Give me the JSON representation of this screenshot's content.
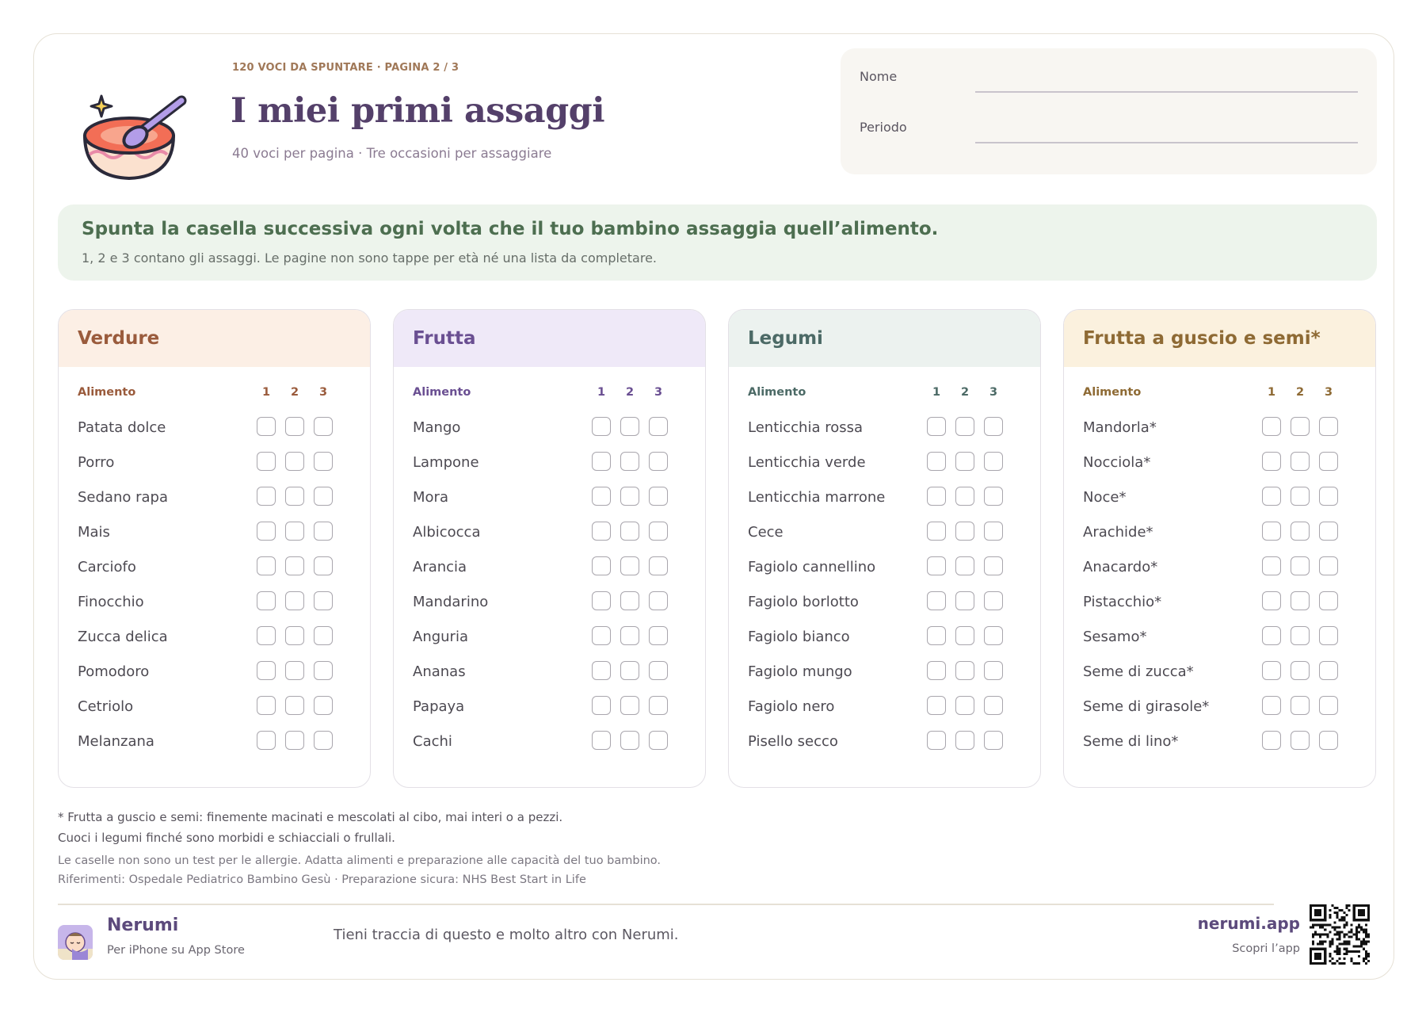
{
  "header": {
    "eyebrow": "120 VOCI DA SPUNTARE · PAGINA 2 / 3",
    "title": "I miei primi assaggi",
    "subtitle": "40 voci per pagina · Tre occasioni per assaggiare",
    "logo_icon": "baby-food-bowl-icon"
  },
  "form": {
    "name_label": "Nome",
    "period_label": "Periodo"
  },
  "banner": {
    "title": "Spunta la casella successiva ogni volta che il tuo bambino assaggia quell’alimento.",
    "subtitle": "1, 2 e 3 contano gli assaggi. Le pagine non sono tappe per età né una lista da completare."
  },
  "table_labels": {
    "food": "Alimento",
    "n1": "1",
    "n2": "2",
    "n3": "3"
  },
  "categories": [
    {
      "title": "Verdure",
      "head_bg": "#fcefe5",
      "accent": "#9a5b3c",
      "items": [
        "Patata dolce",
        "Porro",
        "Sedano rapa",
        "Mais",
        "Carciofo",
        "Finocchio",
        "Zucca delica",
        "Pomodoro",
        "Cetriolo",
        "Melanzana"
      ]
    },
    {
      "title": "Frutta",
      "head_bg": "#efe9f8",
      "accent": "#6a4f92",
      "items": [
        "Mango",
        "Lampone",
        "Mora",
        "Albicocca",
        "Arancia",
        "Mandarino",
        "Anguria",
        "Ananas",
        "Papaya",
        "Cachi"
      ]
    },
    {
      "title": "Legumi",
      "head_bg": "#ecf2ef",
      "accent": "#4c6a66",
      "items": [
        "Lenticchia rossa",
        "Lenticchia verde",
        "Lenticchia marrone",
        "Cece",
        "Fagiolo cannellino",
        "Fagiolo borlotto",
        "Fagiolo bianco",
        "Fagiolo mungo",
        "Fagiolo nero",
        "Pisello secco"
      ]
    },
    {
      "title": "Frutta a guscio e semi*",
      "head_bg": "#fbf1de",
      "accent": "#8e6a34",
      "items": [
        "Mandorla*",
        "Nocciola*",
        "Noce*",
        "Arachide*",
        "Anacardo*",
        "Pistacchio*",
        "Sesamo*",
        "Seme di zucca*",
        "Seme di girasole*",
        "Seme di lino*"
      ]
    }
  ],
  "notes": {
    "line1": "* Frutta a guscio e semi: finemente macinati e mescolati al cibo, mai interi o a pezzi.",
    "line2": "Cuoci i legumi finché sono morbidi e schiacciali o frullali.",
    "line3": "Le caselle non sono un test per le allergie. Adatta alimenti e preparazione alle capacità del tuo bambino.",
    "line4": "Riferimenti: Ospedale Pediatrico Bambino Gesù · Preparazione sicura: NHS Best Start in Life"
  },
  "footer": {
    "brand": "Nerumi",
    "brand_sub": "Per iPhone su App Store",
    "tagline": "Tieni traccia di questo e molto altro con Nerumi.",
    "site": "nerumi.app",
    "site_sub": "Scopri l’app",
    "qr_icon": "qr-code-icon",
    "brand_icon": "sleeping-baby-icon"
  }
}
